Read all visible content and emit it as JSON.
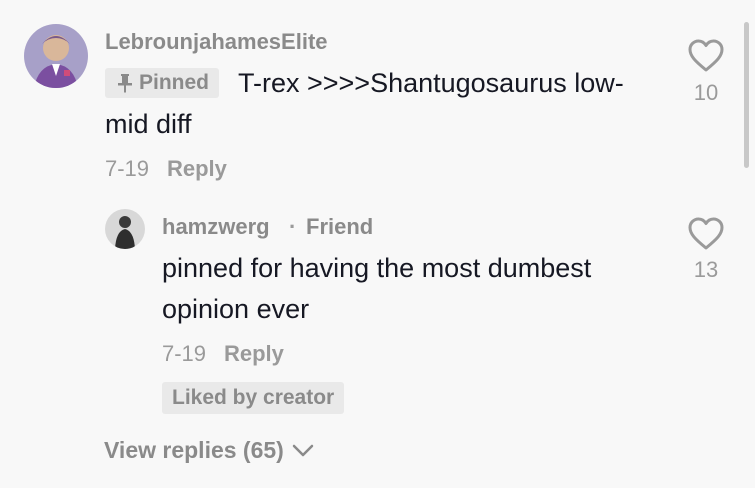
{
  "comment": {
    "username": "LebrounjahamesElite",
    "pinned_label": "Pinned",
    "text_line1": "T-rex >>>>Shantugosaurus low-",
    "text_line2": "mid diff",
    "date": "7-19",
    "reply_label": "Reply",
    "like_count": "10"
  },
  "reply": {
    "username": "hamzwerg",
    "separator": "·",
    "relation": "Friend",
    "text_line1": "pinned for having the most dumbest",
    "text_line2": "opinion ever",
    "date": "7-19",
    "reply_label": "Reply",
    "liked_badge": "Liked by creator",
    "like_count": "13"
  },
  "view_replies_label": "View replies (65)",
  "colors": {
    "background": "#f8f8f8",
    "text": "#161823",
    "muted": "#8a8a8a"
  },
  "icons": {
    "pin": "pin-icon",
    "heart": "heart-outline-icon",
    "chevron": "chevron-down-icon"
  }
}
